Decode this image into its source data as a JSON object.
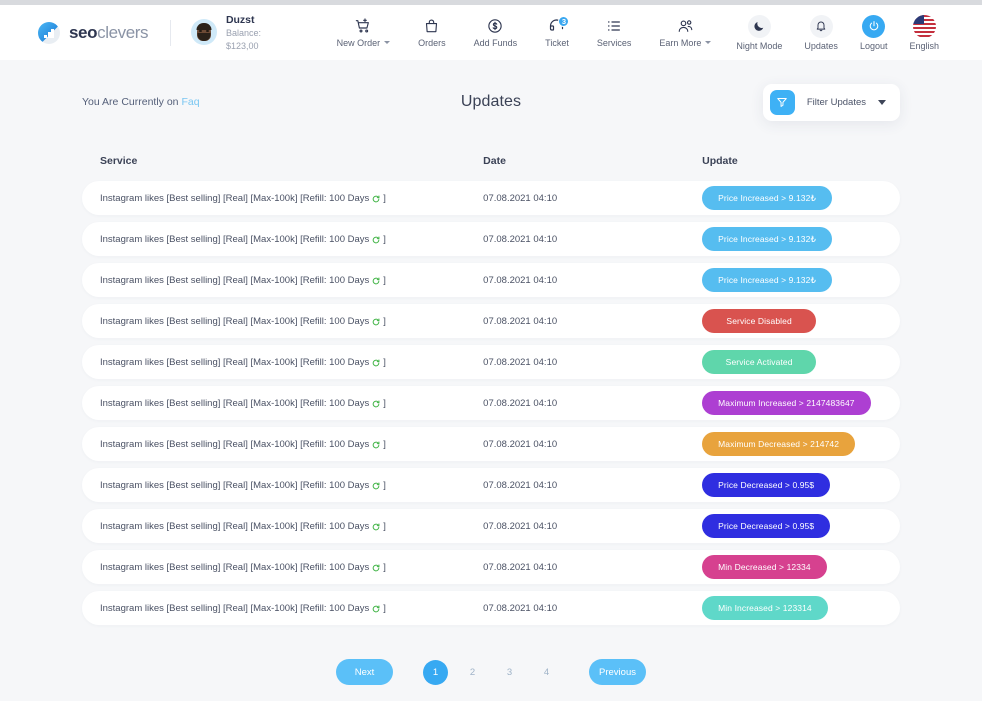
{
  "brand": {
    "name_bold": "seo",
    "name_light": "clevers",
    "logo_icon": "chart-bars-logo-icon"
  },
  "user": {
    "name": "Duzst",
    "balance": "Balance: $123,00",
    "avatar_icon": "user-avatar"
  },
  "nav": {
    "items": [
      {
        "label": "New Order",
        "icon": "cart-icon",
        "has_caret": true,
        "badge": ""
      },
      {
        "label": "Orders",
        "icon": "bag-icon",
        "has_caret": false,
        "badge": ""
      },
      {
        "label": "Add Funds",
        "icon": "dollar-circle-icon",
        "has_caret": false,
        "badge": ""
      },
      {
        "label": "Ticket",
        "icon": "ticket-icon",
        "has_caret": false,
        "badge": "3"
      },
      {
        "label": "Services",
        "icon": "list-icon",
        "has_caret": false,
        "badge": ""
      },
      {
        "label": "Earn More",
        "icon": "users-icon",
        "has_caret": true,
        "badge": ""
      }
    ],
    "right_items": [
      {
        "label": "Night Mode",
        "icon": "moon-icon"
      },
      {
        "label": "Updates",
        "icon": "bell-icon"
      },
      {
        "label": "Logout",
        "icon": "power-icon"
      },
      {
        "label": "English",
        "icon": "flag-us-icon"
      }
    ]
  },
  "page": {
    "breadcrumb_prefix": "You Are Currently on",
    "breadcrumb_link": "Faq",
    "title": "Updates"
  },
  "filter": {
    "label": "Filter Updates",
    "icon": "funnel-icon",
    "caret_icon": "chevron-down-icon"
  },
  "table": {
    "headers": {
      "service": "Service",
      "date": "Date",
      "update": "Update"
    },
    "rows": [
      {
        "service": "Instagram likes [Best selling] [Real] [Max-100k] [Refill: 100 Days",
        "service_suffix": "]",
        "date": "07.08.2021 04:10",
        "update": "Price Increased > 9.132₺",
        "color": "#56bdf0"
      },
      {
        "service": "Instagram likes [Best selling] [Real] [Max-100k] [Refill: 100 Days",
        "service_suffix": "]",
        "date": "07.08.2021 04:10",
        "update": "Price Increased > 9.132₺",
        "color": "#56bdf0"
      },
      {
        "service": "Instagram likes [Best selling] [Real] [Max-100k] [Refill: 100 Days",
        "service_suffix": "]",
        "date": "07.08.2021 04:10",
        "update": "Price Increased > 9.132₺",
        "color": "#56bdf0"
      },
      {
        "service": "Instagram likes [Best selling] [Real] [Max-100k] [Refill: 100 Days",
        "service_suffix": "]",
        "date": "07.08.2021 04:10",
        "update": "Service Disabled",
        "color": "#d9534f"
      },
      {
        "service": "Instagram likes [Best selling] [Real] [Max-100k] [Refill: 100 Days",
        "service_suffix": "]",
        "date": "07.08.2021 04:10",
        "update": "Service Activated",
        "color": "#5fd6ab"
      },
      {
        "service": "Instagram likes [Best selling] [Real] [Max-100k] [Refill: 100 Days",
        "service_suffix": "]",
        "date": "07.08.2021 04:10",
        "update": "Maximum Increased > 2147483647",
        "color": "#ad3fd2"
      },
      {
        "service": "Instagram likes [Best selling] [Real] [Max-100k] [Refill: 100 Days",
        "service_suffix": "]",
        "date": "07.08.2021 04:10",
        "update": "Maximum Decreased > 214742",
        "color": "#e8a33d"
      },
      {
        "service": "Instagram likes [Best selling] [Real] [Max-100k] [Refill: 100 Days",
        "service_suffix": "]",
        "date": "07.08.2021 04:10",
        "update": "Price Decreased > 0.95$",
        "color": "#2f2ee0"
      },
      {
        "service": "Instagram likes [Best selling] [Real] [Max-100k] [Refill: 100 Days",
        "service_suffix": "]",
        "date": "07.08.2021 04:10",
        "update": "Price Decreased > 0.95$",
        "color": "#2f2ee0"
      },
      {
        "service": "Instagram likes [Best selling] [Real] [Max-100k] [Refill: 100 Days",
        "service_suffix": "]",
        "date": "07.08.2021 04:10",
        "update": "Min Decreased > 12334",
        "color": "#d6418f"
      },
      {
        "service": "Instagram likes [Best selling] [Real] [Max-100k] [Refill: 100 Days",
        "service_suffix": "]",
        "date": "07.08.2021 04:10",
        "update": "Min Increased > 123314",
        "color": "#5fd8c9"
      }
    ]
  },
  "pagination": {
    "next_label": "Next",
    "previous_label": "Previous",
    "pages": [
      "1",
      "2",
      "3",
      "4"
    ],
    "active_page": "1"
  },
  "colors": {
    "accent": "#37a9f2",
    "page_bg": "#f6f7f9",
    "card_bg": "#ffffff",
    "link": "#79c6f2"
  }
}
